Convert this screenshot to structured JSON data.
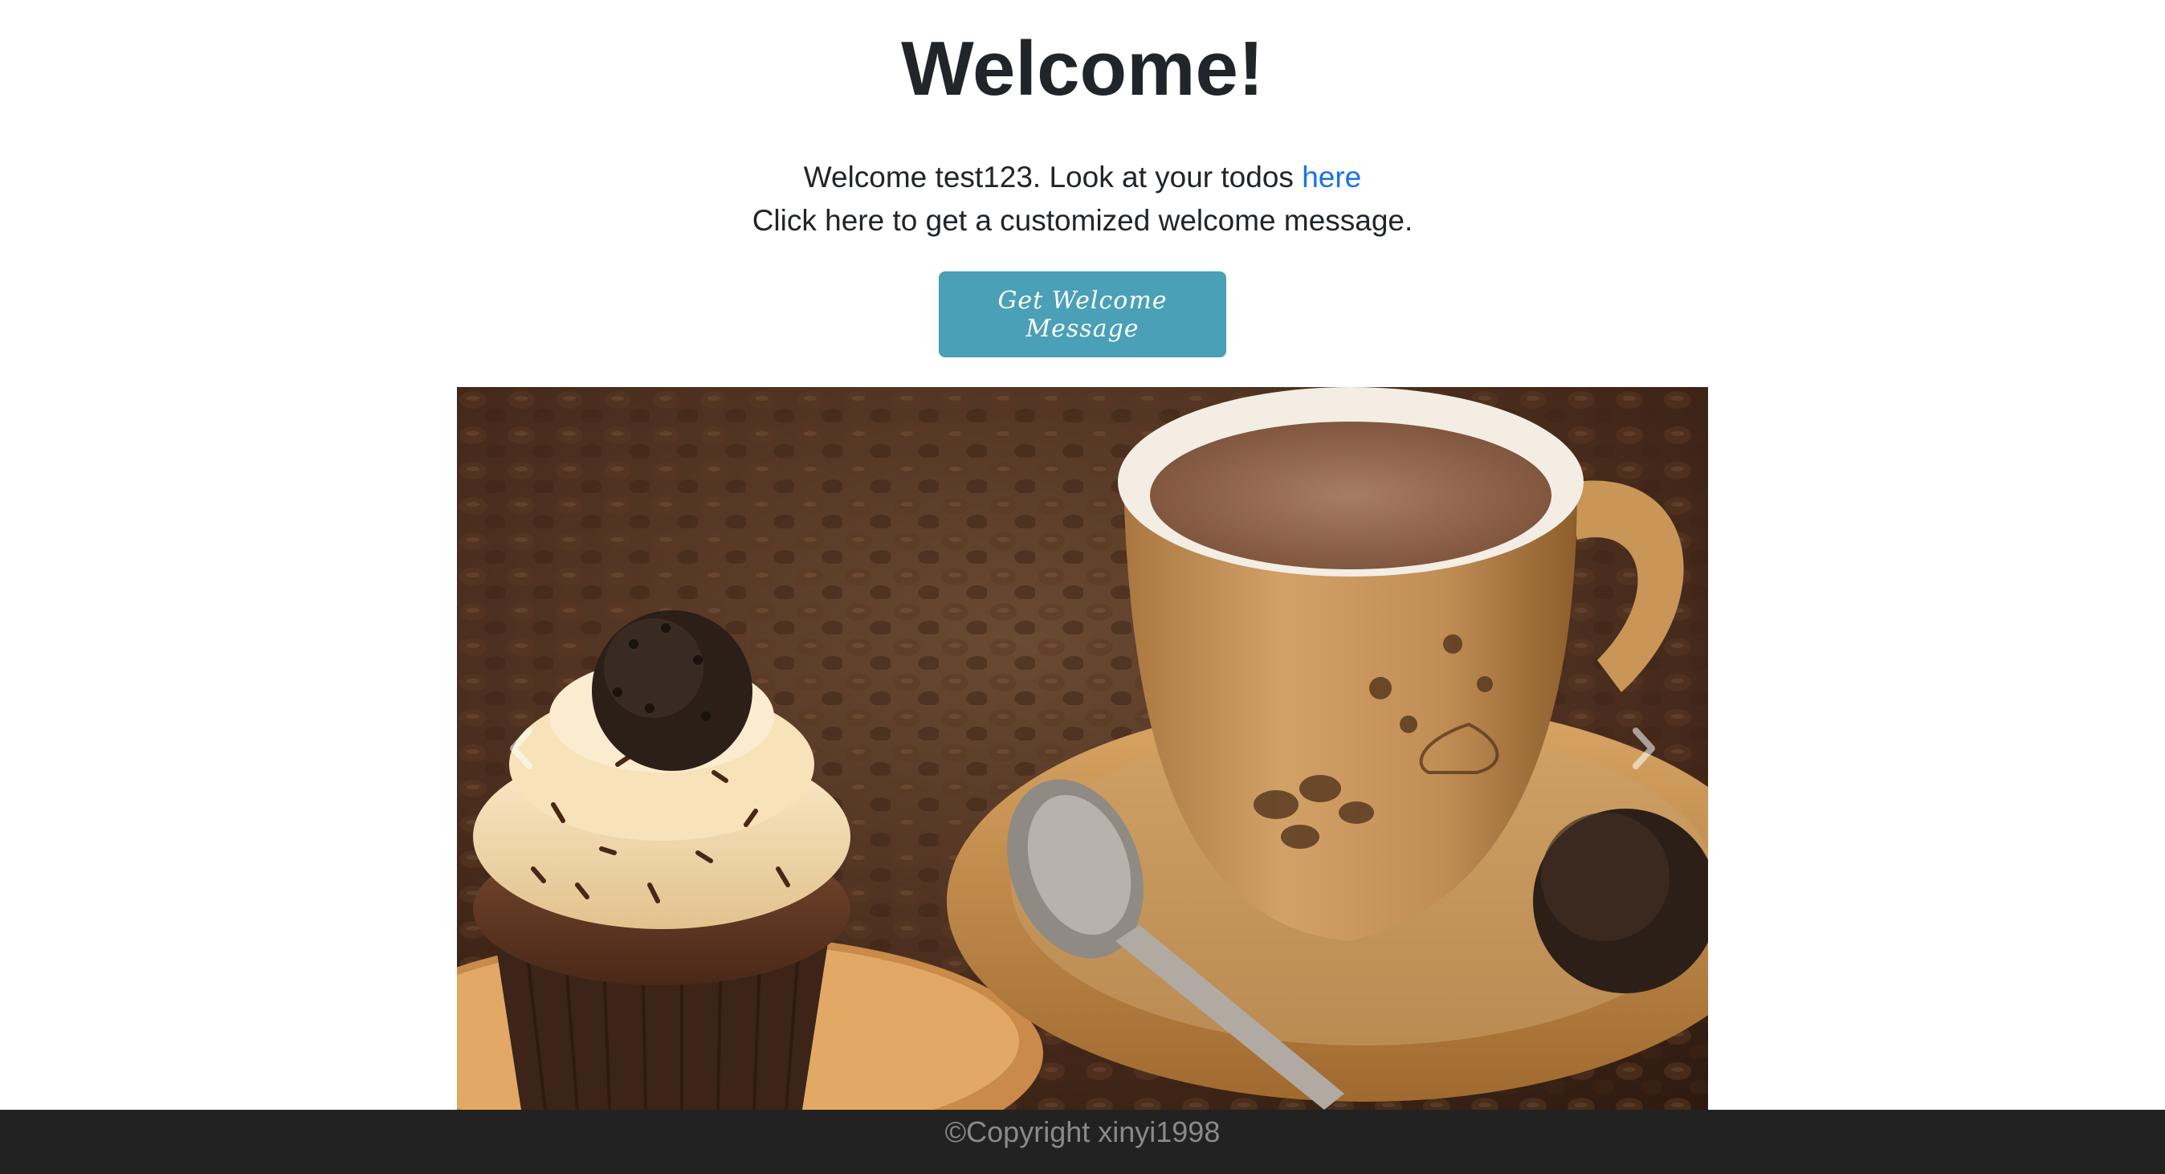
{
  "heading": "Welcome!",
  "intro": {
    "line1_prefix": "Welcome test123. Look at your todos",
    "line1_link": "here",
    "line2": "Click here to get a customized welcome message."
  },
  "welcome_button": {
    "label": "Get Welcome Message"
  },
  "carousel": {
    "image_alt": "Cupcake and coffee cup",
    "prev_icon": "chevron-left-icon",
    "next_icon": "chevron-right-icon"
  },
  "footer": {
    "text": "©Copyright xinyi1998"
  },
  "colors": {
    "button": "#4aa0b7",
    "link": "#1a73e8",
    "footer_bg": "#222222",
    "footer_text": "#8a8a8a"
  }
}
